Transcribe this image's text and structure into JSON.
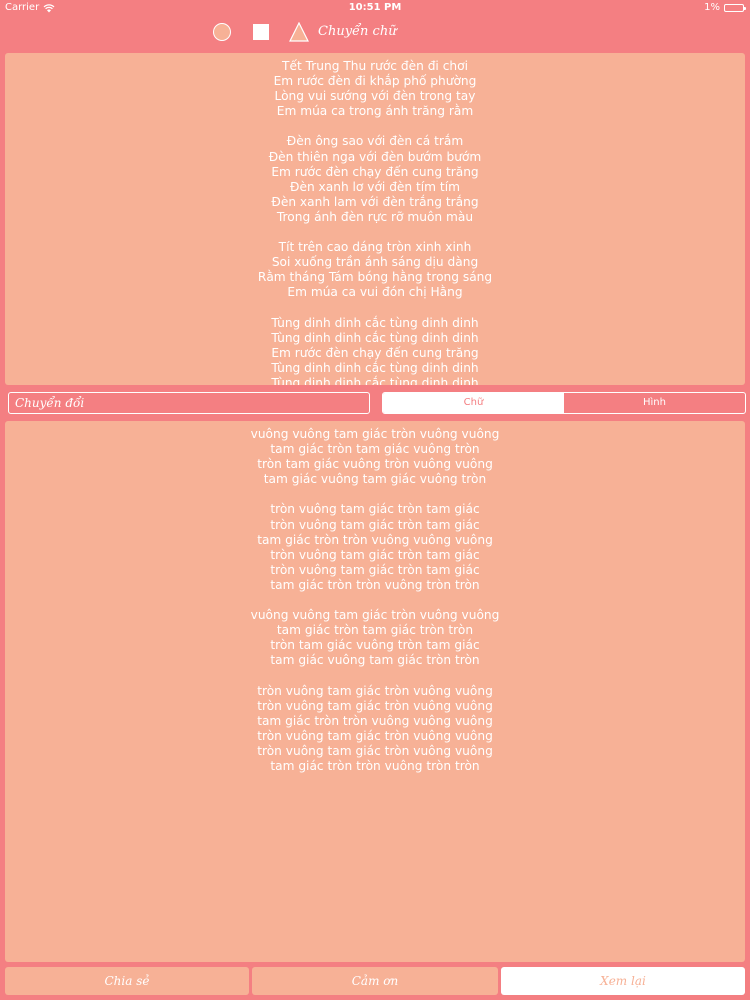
{
  "status_bar": {
    "carrier": "Carrier",
    "time": "10:51 PM",
    "battery": "1%"
  },
  "toolbar": {
    "icons": [
      "circle-icon",
      "square-icon",
      "triangle-icon"
    ],
    "title": "Chuyển chữ"
  },
  "top_text": [
    [
      "Tết Trung Thu rước đèn đi chơi",
      "Em rước đèn đi khắp phố phường",
      "Lòng vui sướng với đèn trong tay",
      "Em múa ca trong ánh trăng rằm"
    ],
    [
      "Đèn ông sao với đèn cá trắm",
      "Đèn thiên nga với đèn bướm bướm",
      "Em rước đèn chạy đến cung trăng",
      "Đèn xanh lơ với đèn tím tím",
      "Đèn xanh lam với đèn trắng trắng",
      "Trong ánh đèn rực rỡ muôn màu"
    ],
    [
      "Tít trên cao dáng tròn xinh xinh",
      "Soi xuống trần ánh sáng dịu dàng",
      "Rằm tháng Tám bóng hằng trong sáng",
      "Em múa ca vui đón chị Hằng"
    ],
    [
      "Tùng dinh dinh cắc tùng dinh dinh",
      "Tùng dinh dinh cắc tùng dinh dinh",
      "Em rước đèn chạy đến cung trăng",
      "Tùng dinh dinh cắc tùng dinh dinh",
      "Tùng dinh dinh cắc tùng dinh dinh"
    ]
  ],
  "input": {
    "placeholder": "Chuyển đổi"
  },
  "segmented": {
    "option1": "Chữ",
    "option2": "Hình"
  },
  "bottom_text": [
    [
      "vuông vuông tam giác tròn vuông vuông",
      "tam giác tròn tam giác vuông tròn",
      "tròn tam giác vuông tròn vuông vuông",
      "tam giác vuông tam giác vuông tròn"
    ],
    [
      "tròn vuông tam giác tròn tam giác",
      "tròn vuông tam giác tròn tam giác",
      "tam giác tròn tròn vuông vuông vuông",
      "tròn vuông tam giác tròn tam giác",
      "tròn vuông tam giác tròn tam giác",
      "tam giác tròn tròn vuông tròn tròn"
    ],
    [
      "vuông vuông tam giác tròn vuông vuông",
      "tam giác tròn tam giác tròn tròn",
      "tròn tam giác vuông tròn tam giác",
      "tam giác vuông tam giác tròn tròn"
    ],
    [
      "tròn vuông tam giác tròn vuông vuông",
      "tròn vuông tam giác tròn vuông vuông",
      "tam giác tròn tròn vuông vuông vuông",
      "tròn vuông tam giác tròn vuông vuông",
      "tròn vuông tam giác tròn vuông vuông",
      "tam giác tròn tròn vuông tròn tròn"
    ]
  ],
  "buttons": {
    "btn1": "Chia sẻ",
    "btn2": "Cảm ơn",
    "btn3": "Xem lại"
  },
  "colors": {
    "background": "#f47f82",
    "panel": "#f7b196",
    "text": "#ffffff"
  }
}
